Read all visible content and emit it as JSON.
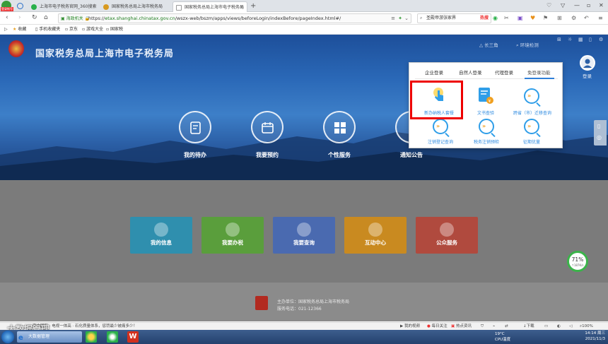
{
  "browser": {
    "badge": "登录帐号",
    "tabs": [
      {
        "label": "上海市电子税务官网_360搜索"
      },
      {
        "label": "国家税务总局上海市税务局"
      },
      {
        "label": "国家税务总局上海市电子税务局"
      }
    ],
    "new_tab": "+",
    "url_secure": "海政机关",
    "url_prefix": "https://",
    "url_host": "etax.shanghai.chinatax.gov.cn",
    "url_path": "/wszx-web/bszm/apps/views/beforeLogin/indexBefore/pageIndex.html#/",
    "search_text": "圣殿帝游张家界",
    "search_hot": "热搜",
    "bookmarks": [
      "收藏",
      "手机收藏夹",
      "京东",
      "游戏大全",
      "国家税"
    ]
  },
  "site": {
    "title": "国家税务总局上海市电子税务局",
    "user_link": "长三角",
    "env_check": "环境检测",
    "login_label": "登录",
    "services": [
      {
        "label": "我的待办"
      },
      {
        "label": "我要预约"
      },
      {
        "label": "个性服务"
      },
      {
        "label": "通知公告"
      }
    ],
    "tiles": [
      {
        "label": "我的信息",
        "color": "#2f8fae"
      },
      {
        "label": "我要办税",
        "color": "#5a9e3c"
      },
      {
        "label": "我要查询",
        "color": "#4a6ab0"
      },
      {
        "label": "互动中心",
        "color": "#c98a20"
      },
      {
        "label": "公众服务",
        "color": "#b04a3e"
      }
    ],
    "footer_org": "主办单位：国家税务总局上海市税务局",
    "footer_phone": "服务电话：021-12366"
  },
  "dropdown": {
    "tabs": [
      "企业登录",
      "自然人登录",
      "代理登录",
      "免登录功能"
    ],
    "active_tab": 3,
    "items": [
      {
        "label": "新办纳税人套餐",
        "icon": "hand-pointer-icon",
        "highlighted": true
      },
      {
        "label": "文书查验",
        "icon": "document-check-icon"
      },
      {
        "label": "跨省（市）迁移查询",
        "icon": "search-arrow-icon"
      },
      {
        "label": "注销登记查询",
        "icon": "search-arrow-icon"
      },
      {
        "label": "税务注销预检",
        "icon": "search-arrow-icon"
      },
      {
        "label": "征期优量",
        "icon": "search-arrow-icon"
      }
    ]
  },
  "speed": {
    "percent": "71%",
    "rate": "↑187K/s"
  },
  "status_bar": {
    "news": "南中国际 · 电视一体高 · 石化质量体系，惩罚最少被痛多少！",
    "items": [
      "我的视频",
      "每日关注",
      "热点资讯",
      "下载",
      "100%"
    ]
  },
  "taskbar": {
    "app": "大数据管理",
    "weather_temp": "19°C",
    "weather_desc": "CPU温度",
    "time": "14:14 周三",
    "date": "2021/11/3"
  },
  "watermark": "大数据管理"
}
